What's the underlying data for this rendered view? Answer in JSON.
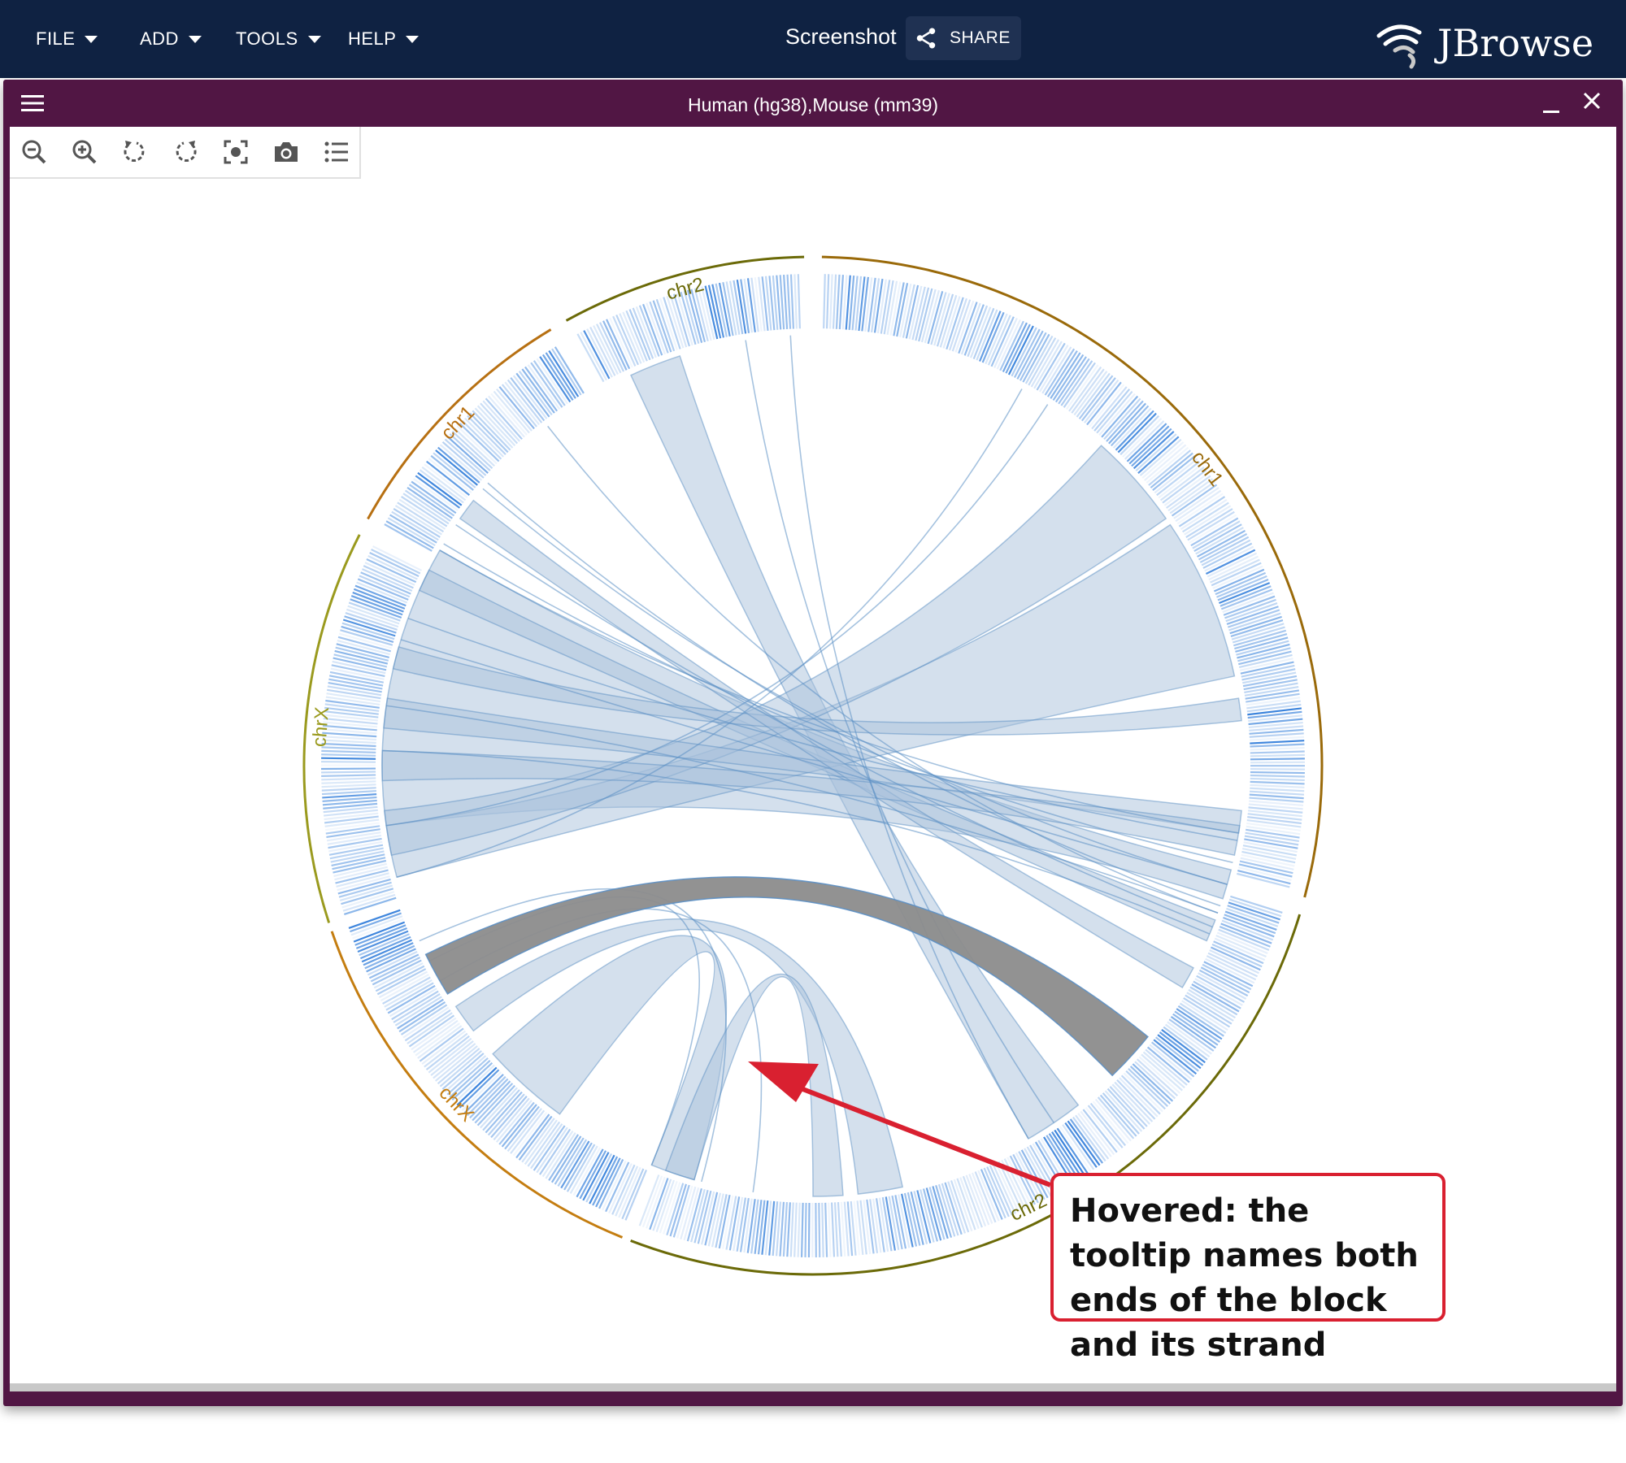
{
  "menu": [
    {
      "label": "FILE"
    },
    {
      "label": "ADD"
    },
    {
      "label": "TOOLS"
    },
    {
      "label": "HELP"
    }
  ],
  "session_name": "Screenshot",
  "share_label": "SHARE",
  "logo_text": "JBrowse",
  "view": {
    "title": "Human (hg38),Mouse (mm39)"
  },
  "toolbar": {
    "zoom_out": "zoom-out-icon",
    "zoom_in": "zoom-in-icon",
    "rotate_ccw": "rotate-ccw-icon",
    "rotate_cw": "rotate-cw-icon",
    "fit": "fit-view-icon",
    "screenshot": "camera-icon",
    "tracks": "track-list-icon"
  },
  "chromosomes": [
    {
      "label": "chr1",
      "color": "#9a6a0a",
      "startAngle": 1,
      "endAngle": 105
    },
    {
      "label": "chr2",
      "color": "#6b6a08",
      "startAngle": 107,
      "endAngle": 201
    },
    {
      "label": "chrX",
      "color": "#c47d10",
      "startAngle": 202,
      "endAngle": 251
    },
    {
      "label": "chrX",
      "color": "#9a9a1e",
      "startAngle": 252,
      "endAngle": 297
    },
    {
      "label": "chr1",
      "color": "#b77012",
      "startAngle": 299,
      "endAngle": 329
    },
    {
      "label": "chr2",
      "color": "#6b6a08",
      "startAngle": 331,
      "endAngle": 359
    }
  ],
  "colors": {
    "ribbon": "#a9c1dc",
    "ribbon_stroke": "#5b8fc4",
    "hovered": "#8c8c8c",
    "heat": "#1a6fd6",
    "annotation": "#d92030"
  },
  "annotation": {
    "text": "Hovered: the tooltip names both ends of the block and its strand"
  }
}
